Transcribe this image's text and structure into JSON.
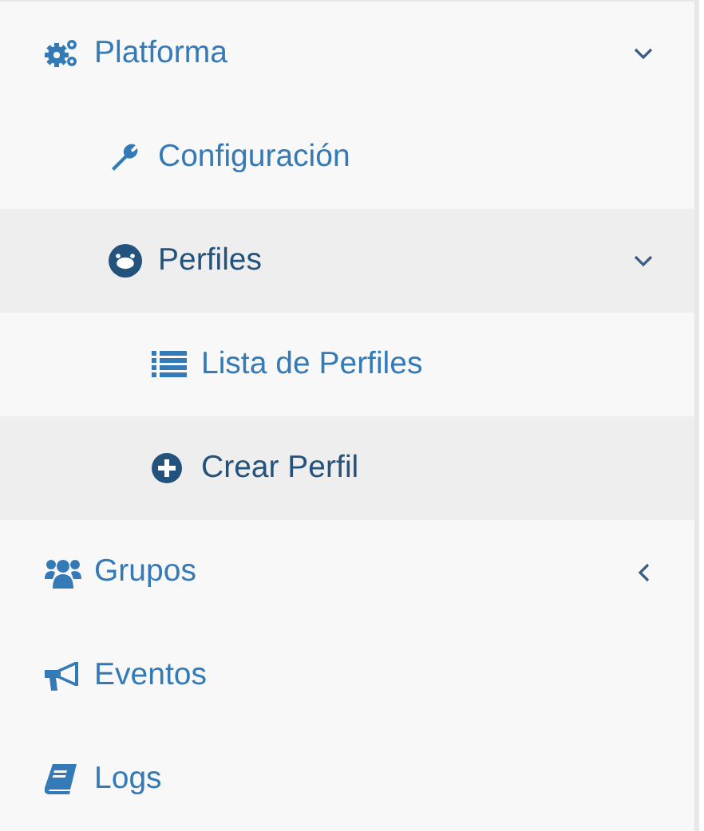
{
  "menu": [
    {
      "label": "Platforma",
      "selected": false,
      "expanded": true,
      "children": [
        {
          "label": "Configuración",
          "selected": false
        },
        {
          "label": "Perfiles",
          "selected": true,
          "expanded": true,
          "children": [
            {
              "label": "Lista de Perfiles",
              "selected": false
            },
            {
              "label": "Crear Perfil",
              "selected": true
            }
          ]
        }
      ]
    },
    {
      "label": "Grupos",
      "selected": false,
      "expanded": false
    },
    {
      "label": "Eventos",
      "selected": false
    },
    {
      "label": "Logs",
      "selected": false
    }
  ]
}
